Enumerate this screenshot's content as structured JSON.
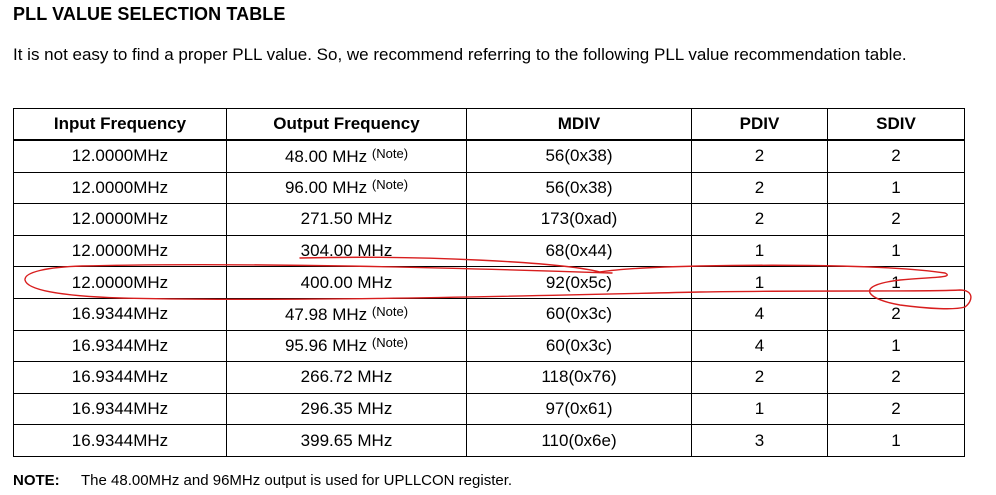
{
  "title": "PLL VALUE SELECTION TABLE",
  "intro": "It is not easy to find a proper PLL value. So, we recommend referring to the following PLL value recommendation table.",
  "table": {
    "headers": [
      "Input Frequency",
      "Output Frequency",
      "MDIV",
      "PDIV",
      "SDIV"
    ],
    "rows": [
      {
        "input": "12.0000MHz",
        "output": "48.00 MHz",
        "note": "(Note)",
        "mdiv": "56(0x38)",
        "pdiv": "2",
        "sdiv": "2"
      },
      {
        "input": "12.0000MHz",
        "output": "96.00 MHz",
        "note": "(Note)",
        "mdiv": "56(0x38)",
        "pdiv": "2",
        "sdiv": "1"
      },
      {
        "input": "12.0000MHz",
        "output": "271.50 MHz",
        "note": "",
        "mdiv": "173(0xad)",
        "pdiv": "2",
        "sdiv": "2"
      },
      {
        "input": "12.0000MHz",
        "output": "304.00 MHz",
        "note": "",
        "mdiv": "68(0x44)",
        "pdiv": "1",
        "sdiv": "1"
      },
      {
        "input": "12.0000MHz",
        "output": "400.00 MHz",
        "note": "",
        "mdiv": "92(0x5c)",
        "pdiv": "1",
        "sdiv": "1"
      },
      {
        "input": "16.9344MHz",
        "output": "47.98 MHz",
        "note": "(Note)",
        "mdiv": "60(0x3c)",
        "pdiv": "4",
        "sdiv": "2"
      },
      {
        "input": "16.9344MHz",
        "output": "95.96 MHz",
        "note": "(Note)",
        "mdiv": "60(0x3c)",
        "pdiv": "4",
        "sdiv": "1"
      },
      {
        "input": "16.9344MHz",
        "output": "266.72 MHz",
        "note": "",
        "mdiv": "118(0x76)",
        "pdiv": "2",
        "sdiv": "2"
      },
      {
        "input": "16.9344MHz",
        "output": "296.35 MHz",
        "note": "",
        "mdiv": "97(0x61)",
        "pdiv": "1",
        "sdiv": "2"
      },
      {
        "input": "16.9344MHz",
        "output": "399.65 MHz",
        "note": "",
        "mdiv": "110(0x6e)",
        "pdiv": "3",
        "sdiv": "1"
      }
    ]
  },
  "footer": {
    "label": "NOTE:",
    "text": "The 48.00MHz and 96MHz output is used for UPLLCON register."
  },
  "annotation": {
    "description": "hand-drawn red outline around the 400.00 MHz row",
    "color": "#d81e1e"
  }
}
